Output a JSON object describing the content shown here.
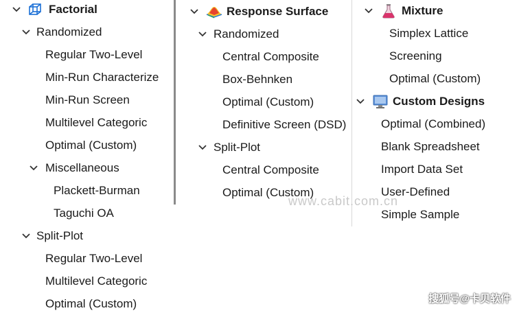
{
  "factorial": {
    "header": "Factorial",
    "randomized": {
      "label": "Randomized",
      "items": [
        "Regular Two-Level",
        "Min-Run Characterize",
        "Min-Run Screen",
        "Multilevel Categoric",
        "Optimal (Custom)"
      ],
      "miscellaneous": {
        "label": "Miscellaneous",
        "items": [
          "Plackett-Burman",
          "Taguchi OA"
        ]
      }
    },
    "split_plot": {
      "label": "Split-Plot",
      "items": [
        "Regular Two-Level",
        "Multilevel Categoric",
        "Optimal (Custom)"
      ]
    }
  },
  "response_surface": {
    "header": "Response Surface",
    "randomized": {
      "label": "Randomized",
      "items": [
        "Central Composite",
        "Box-Behnken",
        "Optimal (Custom)",
        "Definitive Screen (DSD)"
      ]
    },
    "split_plot": {
      "label": "Split-Plot",
      "items": [
        "Central Composite",
        "Optimal (Custom)"
      ]
    }
  },
  "mixture": {
    "header": "Mixture",
    "items": [
      "Simplex Lattice",
      "Screening",
      "Optimal (Custom)"
    ]
  },
  "custom_designs": {
    "header": "Custom Designs",
    "items": [
      "Optimal (Combined)",
      "Blank Spreadsheet",
      "Import Data Set",
      "User-Defined",
      "Simple Sample"
    ]
  },
  "watermark": {
    "url": "www.cabit.com.cn",
    "credit": "搜狐号@卡贝软件"
  },
  "colors": {
    "factorial_icon": "#1a6fd6",
    "mixture_icon": "#d9336b",
    "custom_icon": "#5a8fd8",
    "chevron": "#333333"
  },
  "icons": {
    "factorial": "cube-icon",
    "response_surface": "surface-icon",
    "mixture": "flask-icon",
    "custom_designs": "monitor-icon"
  }
}
